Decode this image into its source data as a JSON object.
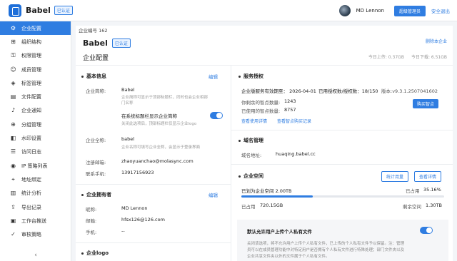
{
  "header": {
    "brand": "Babel",
    "auth_badge": "已认证",
    "user_name": "MD Lennon",
    "admin_button": "超级管理员",
    "logout": "安全退出"
  },
  "sidebar": {
    "items": [
      {
        "label": "企业配置",
        "icon": "gear-icon",
        "active": true
      },
      {
        "label": "组织结构",
        "icon": "org-icon",
        "active": false
      },
      {
        "label": "权限管理",
        "icon": "key-icon",
        "active": false
      },
      {
        "label": "成员管理",
        "icon": "people-icon",
        "active": false
      },
      {
        "label": "标签管理",
        "icon": "tag-icon",
        "active": false
      },
      {
        "label": "文件配置",
        "icon": "file-icon",
        "active": false
      },
      {
        "label": "企业通知",
        "icon": "bell-icon",
        "active": false
      },
      {
        "label": "分组管理",
        "icon": "group-icon",
        "active": false
      },
      {
        "label": "水印设置",
        "icon": "watermark-icon",
        "active": false
      },
      {
        "label": "访问日志",
        "icon": "log-icon",
        "active": false
      },
      {
        "label": "IP 策略列表",
        "icon": "ip-icon",
        "active": false
      },
      {
        "label": "地址绑定",
        "icon": "location-icon",
        "active": false
      },
      {
        "label": "统计分析",
        "icon": "chart-icon",
        "active": false
      },
      {
        "label": "导出记录",
        "icon": "export-icon",
        "active": false
      },
      {
        "label": "工作台推送",
        "icon": "push-icon",
        "active": false
      },
      {
        "label": "审核策略",
        "icon": "audit-icon",
        "active": false
      }
    ],
    "collapse_glyph": "‹"
  },
  "main": {
    "enterprise_no": "企业编号 162",
    "delete_enterprise": "删除本企业",
    "enterprise_name": "Babel",
    "auth_badge": "已认证",
    "page_title": "企业配置",
    "upload_today": "今日上传: 0.37GB",
    "download_today": "今日下载: 6.51GB"
  },
  "basic_info": {
    "title": "基本信息",
    "edit": "编辑",
    "short_name_label": "企业简称:",
    "short_name_value": "Babel",
    "short_name_hint_1": "企业简称可显示于顶部标题栏，同时也会企业相部",
    "short_name_hint_2": "门名称",
    "show_in_title_label": "在系统标题栏显示企业简称",
    "show_in_title_enabled": true,
    "show_in_title_hint": "关闭此选项后，顶部标题栏仅显示企业logo",
    "full_name_label": "企业全称:",
    "full_name_value": "babel",
    "full_name_hint": "企业名称可填写企业全称，会显示于登录界面",
    "email_label": "注册邮箱:",
    "email_value": "zhaoyuanchao@molasync.com",
    "phone_label": "联系手机:",
    "phone_value": "13917156923"
  },
  "owner": {
    "title": "企业拥有者",
    "edit": "编辑",
    "nickname_label": "昵称:",
    "nickname_value": "MD Lennon",
    "email_label": "邮箱:",
    "email_value": "hfsx126@126.com",
    "phone_label": "手机:",
    "phone_value": "--"
  },
  "logo_section": {
    "title": "企业logo"
  },
  "service": {
    "title": "服务授权",
    "expiry_line": "企业版服务有效期至： 2026-04-01",
    "seats_line": "已用授权数/授权数：18/150",
    "version": "版本:v9.3.1.2507041602",
    "remaining_points_label": "你剩余的智点数量:",
    "remaining_points_value": "1243",
    "used_points_label": "已使用的智点数量:",
    "used_points_value": "8757",
    "buy_button": "购买智点",
    "view_details": "查看使用详情",
    "view_purchase": "查看智点购买记录"
  },
  "domain": {
    "title": "域名管理",
    "label": "域名地址:",
    "value": "huaqing.babel.cc"
  },
  "space": {
    "title": "企业空间",
    "stats_button": "统计用量",
    "details_button": "查看详情",
    "allocated_label": "已划为企业空间 2.00TB",
    "used_percent_label": "已占用",
    "used_percent_value": "35.16%",
    "used_fraction": 0.3516,
    "used_size_label": "已占用",
    "used_size_value": "720.15GB",
    "remaining_label": "剩余空间",
    "remaining_value": "1.30TB"
  },
  "private_files": {
    "title": "默认允许用户上传个人私有文件",
    "enabled": true,
    "hint_1": "关闭该选项，将不允许用户上传个人私有文件，已上传的个人私有文件予以保留。注：管理",
    "hint_2": "员可以在成员管理功能中对特定用户是否拥有个人私有文件进行特殊处理；部门文件夹以及",
    "hint_3": "企业共享文件夹以外的文件属于个人私有文件。"
  },
  "colors": {
    "accent": "#2f7de1",
    "sidebar_active": "#2f7de1",
    "background": "#f3f5f8"
  }
}
